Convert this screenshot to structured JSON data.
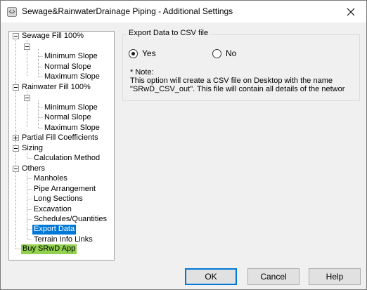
{
  "window": {
    "title": "Sewage&RainwaterDrainage Piping  - Additional Settings"
  },
  "tree": {
    "sewage": "Sewage Fill 100%",
    "sewage_children": [
      "Minimum Slope",
      "Normal Slope",
      "Maximum Slope"
    ],
    "rainwater": "Rainwater Fill 100%",
    "rainwater_children": [
      "Minimum Slope",
      "Normal Slope",
      "Maximum Slope"
    ],
    "partial": "Partial Fill Coefficients",
    "sizing": "Sizing",
    "sizing_children": [
      "Calculation Method"
    ],
    "others": "Others",
    "others_children": [
      "Manholes",
      "Pipe Arrangement",
      "Long Sections",
      "Excavation",
      "Schedules/Quantities",
      "Export Data",
      "Terrain Info Links"
    ],
    "buy": "Buy SRwD App",
    "selected": "Export Data",
    "highlight_color": "#92d050",
    "selected_color": "#0078d7"
  },
  "export": {
    "group_title": "Export Data to CSV file",
    "yes_label": "Yes",
    "no_label": "No",
    "selected_option": "Yes",
    "note_title": "*  Note:",
    "note_line1": "This option will create a CSV file on Desktop with the name",
    "note_line2": "\"SRwD_CSV_out\". This file will contain all details of the networ"
  },
  "buttons": {
    "ok": "OK",
    "cancel": "Cancel",
    "help": "Help"
  }
}
